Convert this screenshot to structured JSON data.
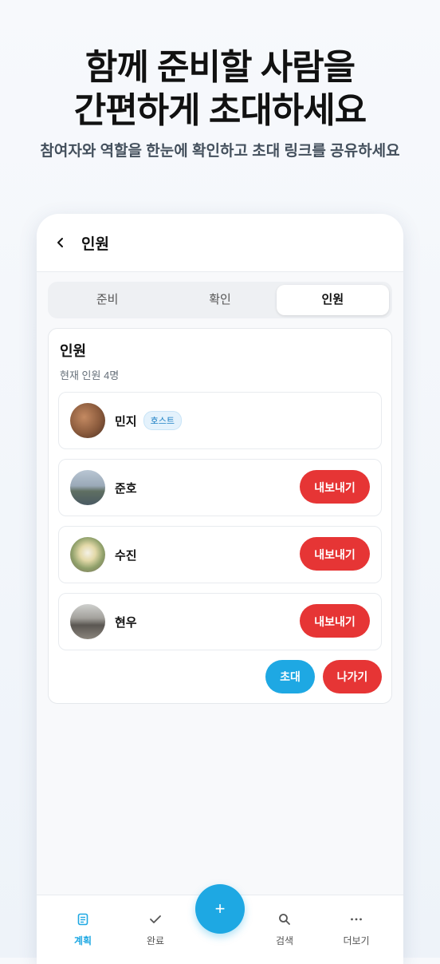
{
  "promo": {
    "headline_line1": "함께 준비할 사람을",
    "headline_line2": "간편하게 초대하세요",
    "subline": "참여자와 역할을 한눈에 확인하고 초대 링크를 공유하세요"
  },
  "appbar": {
    "back_icon": "chevron-left-icon",
    "title": "인원"
  },
  "tabs": [
    {
      "label": "준비",
      "active": false
    },
    {
      "label": "확인",
      "active": false
    },
    {
      "label": "인원",
      "active": true
    }
  ],
  "members_card": {
    "title": "인원",
    "subtitle": "현재 인원 4명",
    "members": [
      {
        "name": "민지",
        "badge": "호스트",
        "avatar_color": "#8a5a3c"
      },
      {
        "name": "준호",
        "action": "내보내기",
        "avatar_color": "#7c8fa3"
      },
      {
        "name": "수진",
        "action": "내보내기",
        "avatar_color": "#c8b27a"
      },
      {
        "name": "현우",
        "action": "내보내기",
        "avatar_color": "#6e6a66"
      }
    ],
    "invite_label": "초대",
    "leave_label": "나가기"
  },
  "bottom_nav": {
    "items": [
      {
        "label": "계획",
        "icon": "document-icon",
        "active": true
      },
      {
        "label": "완료",
        "icon": "check-icon",
        "active": false
      },
      {
        "label": "검색",
        "icon": "search-icon",
        "active": false
      },
      {
        "label": "더보기",
        "icon": "more-icon",
        "active": false
      }
    ],
    "fab_label": "+"
  },
  "colors": {
    "accent": "#1ea8e3",
    "danger": "#e63535"
  }
}
